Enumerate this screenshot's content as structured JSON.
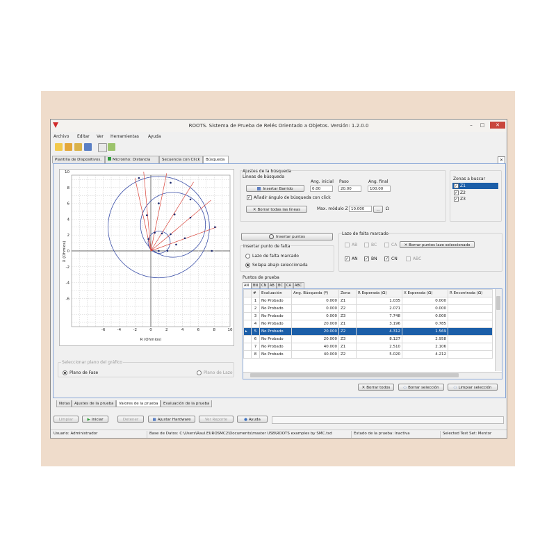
{
  "window": {
    "title": "ROOTS. Sistema de Prueba de Relés Orientado a Objetos. Versión: 1.2.0.0"
  },
  "menu": [
    "Archivo",
    "Editar",
    "Ver",
    "Herramientas",
    "Ayuda"
  ],
  "tabs": [
    "Plantilla de Dispositivos.",
    "Micronho: Distancia",
    "Secuencia con Click",
    "Búsqueda"
  ],
  "chart": {
    "xlabel": "R (Ohmios)",
    "ylabel": "X (Ohmios)",
    "xticks": [
      "-6",
      "-4",
      "-2",
      "0",
      "2",
      "4",
      "6",
      "8",
      "10"
    ],
    "yticks": [
      "10",
      "8",
      "6",
      "4",
      "2",
      "0",
      "-2",
      "-4",
      "-6"
    ]
  },
  "plane": {
    "legend": "Seleccionar plano del gráfico",
    "phase": "Plano de Fase",
    "loop": "Plano de Lazo"
  },
  "search_settings": {
    "group": "Ajustes de la búsqueda",
    "lines_label": "Líneas de búsqueda",
    "insert_sweep": "Insertar Barrido",
    "angle_start_label": "Ang. inicial",
    "step_label": "Paso",
    "angle_end_label": "Ang. final",
    "angle_start": "0.00",
    "step": "20.00",
    "angle_end": "100.00",
    "add_angle_click": "Añadir ángulo de búsqueda con click",
    "clear_lines": "Borrar todas las líneas",
    "max_module_label": "Max. módulo Z",
    "max_module": "10.000",
    "browse": "...",
    "unit": "Ω"
  },
  "zones": {
    "title": "Zonas a buscar",
    "items": [
      "Z1",
      "Z2",
      "Z3"
    ]
  },
  "insert_points": "Insertar puntos",
  "insert_fault": {
    "group": "Insertar punto de falta",
    "marked": "Lazo de falta marcado",
    "tab": "Solapa abajo seleccionada"
  },
  "fault_loop": {
    "group": "Lazo de falta marcado",
    "AB": "AB",
    "BC": "BC",
    "CA": "CA",
    "AN": "AN",
    "BN": "BN",
    "CN": "CN",
    "ABC": "ABC",
    "clear_selected": "Borrar puntos lazo seleccionado"
  },
  "test_points": {
    "label": "Puntos de prueba",
    "loop_tabs": [
      "AN",
      "BN",
      "CN",
      "AB",
      "BC",
      "CA",
      "ABC"
    ],
    "columns": [
      "#",
      "Evaluación",
      "Ang. Búsqueda (º)",
      "Zona",
      "R Esperada (Ω)",
      "X Esperada (Ω)",
      "R Encontrada (Ω)"
    ],
    "rows": [
      [
        "1",
        "No Probado",
        "0.000",
        "Z1",
        "1.035",
        "0.000",
        ""
      ],
      [
        "2",
        "No Probado",
        "0.000",
        "Z2",
        "2.071",
        "0.000",
        ""
      ],
      [
        "3",
        "No Probado",
        "0.000",
        "Z3",
        "7.748",
        "0.000",
        ""
      ],
      [
        "4",
        "No Probado",
        "20.000",
        "Z1",
        "3.196",
        "0.785",
        ""
      ],
      [
        "5",
        "No Probado",
        "20.000",
        "Z2",
        "4.312",
        "1.569",
        ""
      ],
      [
        "6",
        "No Probado",
        "20.000",
        "Z3",
        "8.127",
        "2.958",
        ""
      ],
      [
        "7",
        "No Probado",
        "40.000",
        "Z1",
        "2.510",
        "2.106",
        ""
      ],
      [
        "8",
        "No Probado",
        "40.000",
        "Z2",
        "5.020",
        "4.212",
        ""
      ]
    ],
    "clear_all": "Borrar todos",
    "clear_selection": "Borrar selección",
    "clean_selection": "Limpiar selección"
  },
  "bottom_tabs": [
    "Notas",
    "Ajustes de la prueba",
    "Valores de la prueba",
    "Evaluación de la prueba"
  ],
  "actions": [
    "Limpiar",
    "Iniciar",
    "Detener",
    "Ajustar Hardware",
    "Ver Reporte",
    "Ayuda"
  ],
  "status": {
    "user": "Usuario: Administrador",
    "db": "Base de Datos:  C:\\Users\\Raul.EUROSMC2\\Documents\\master USB\\ROOTS examples by SMC.tsd",
    "state": "Estado de la prueba: Inactiva",
    "testset": "Selected Test Set: Mentor"
  },
  "colors": {
    "accent": "#1b5ea8",
    "circle": "#3a4fa8",
    "line": "#d9443a"
  }
}
